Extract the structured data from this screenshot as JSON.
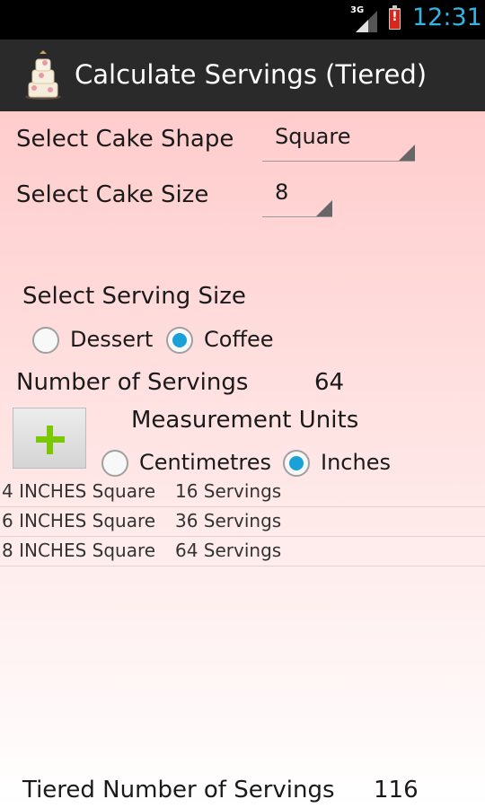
{
  "status_bar": {
    "network_type": "3G",
    "battery_warning": "!",
    "time": "12:31"
  },
  "action_bar": {
    "title": "Calculate Servings (Tiered)",
    "icon": "cake-icon"
  },
  "form": {
    "shape_label": "Select Cake Shape",
    "shape_value": "Square",
    "size_label": "Select Cake Size",
    "size_value": "8",
    "serving_size_label": "Select Serving Size",
    "serving_options": [
      {
        "label": "Dessert",
        "checked": false
      },
      {
        "label": "Coffee",
        "checked": true
      }
    ],
    "servings_label": "Number of Servings",
    "servings_value": "64",
    "units_label": "Measurement Units",
    "unit_options": [
      {
        "label": "Centimetres",
        "checked": false
      },
      {
        "label": "Inches",
        "checked": true
      }
    ],
    "add_button_icon": "plus-icon"
  },
  "tiers": [
    {
      "name": "4 INCHES Square",
      "servings": "16 Servings"
    },
    {
      "name": "6 INCHES Square",
      "servings": "36 Servings"
    },
    {
      "name": "8 INCHES Square",
      "servings": "64 Servings"
    }
  ],
  "total": {
    "label": "Tiered Number of Servings",
    "value": "116"
  },
  "colors": {
    "accent": "#33b5e5",
    "radio_checked": "#1aa1d8",
    "plus_green": "#7cc800",
    "action_bar": "#2a2a2a",
    "background_top": "#ffcccc"
  }
}
